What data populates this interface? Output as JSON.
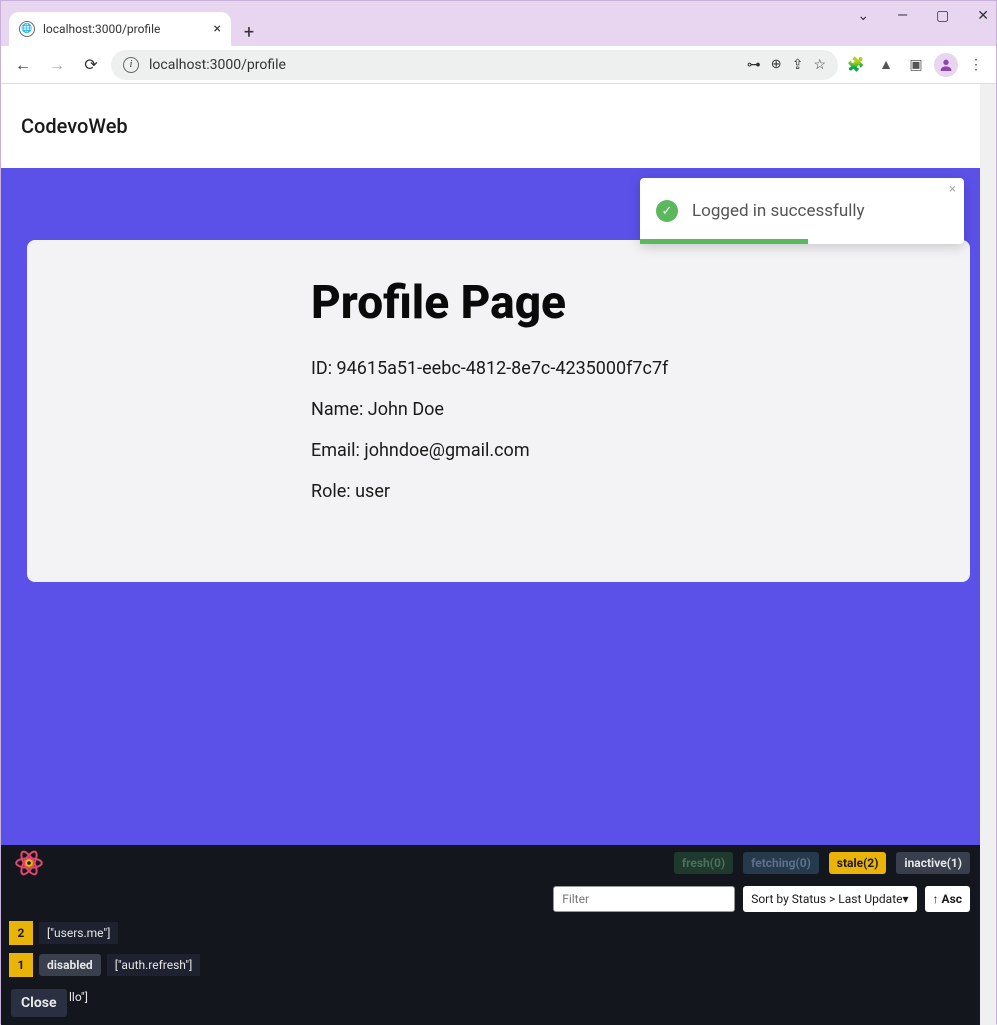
{
  "browser": {
    "tab_title": "localhost:3000/profile",
    "url": "localhost:3000/profile"
  },
  "header": {
    "brand": "CodevoWeb"
  },
  "toast": {
    "message": "Logged in successfully",
    "close": "×"
  },
  "profile": {
    "title": "Profile Page",
    "id_label": "ID:",
    "id_value": "94615a51-eebc-4812-8e7c-4235000f7c7f",
    "name_label": "Name:",
    "name_value": "John Doe",
    "email_label": "Email:",
    "email_value": "johndoe@gmail.com",
    "role_label": "Role:",
    "role_value": "user"
  },
  "devtools": {
    "status": {
      "fresh_label": "fresh",
      "fresh_count": "(0)",
      "fetching_label": "fetching",
      "fetching_count": "(0)",
      "stale_label": "stale",
      "stale_count": "(2)",
      "inactive_label": "inactive",
      "inactive_count": "(1)"
    },
    "filter_placeholder": "Filter",
    "sort_label": "Sort by Status > Last Update",
    "asc_label": "↑ Asc",
    "rows": [
      {
        "count": "2",
        "disabled": "",
        "key": "[\"users.me\"]"
      },
      {
        "count": "1",
        "disabled": "disabled",
        "key": "[\"auth.refresh\"]"
      },
      {
        "count": "",
        "disabled": "",
        "key": "llo\"]"
      }
    ],
    "close_label": "Close"
  }
}
